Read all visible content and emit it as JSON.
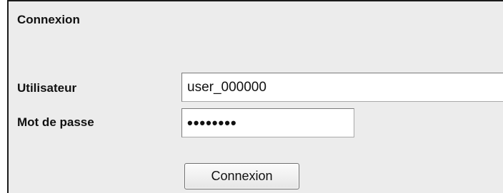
{
  "form": {
    "title": "Connexion",
    "username_label": "Utilisateur",
    "username_value": "user_000000",
    "password_label": "Mot de passe",
    "password_value": "••••••••",
    "submit_label": "Connexion"
  }
}
